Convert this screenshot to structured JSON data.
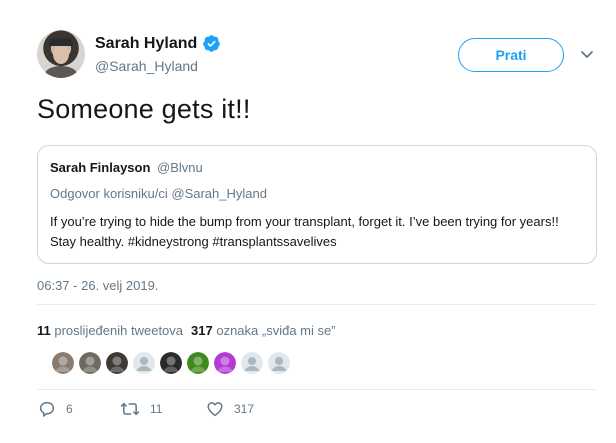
{
  "author": {
    "display_name": "Sarah Hyland",
    "handle": "@Sarah_Hyland",
    "verified": true
  },
  "follow_button": {
    "label": "Prati",
    "color": "#1da1f2"
  },
  "tweet": {
    "text": "Someone gets it!!",
    "timestamp": "06:37 - 26. velj 2019."
  },
  "quoted_tweet": {
    "display_name": "Sarah Finlayson",
    "handle": "@Blvnu",
    "reply_context": "Odgovor korisniku/ci @Sarah_Hyland",
    "text": "If you’re trying to hide the bump from your transplant, forget it. I’ve been trying for years!! Stay healthy. #kidneystrong #transplantssavelives"
  },
  "stats": {
    "retweet_count": "11",
    "retweet_label": "proslijeđenih tweetova",
    "like_count": "317",
    "like_label": "oznaka „sviđa mi se”"
  },
  "likers": [
    {
      "icon": "avatar",
      "color": "#8a7b6e"
    },
    {
      "icon": "avatar",
      "color": "#6e6a62"
    },
    {
      "icon": "avatar",
      "color": "#3c3a33"
    },
    {
      "icon": "default-avatar",
      "color": "#aab8c2"
    },
    {
      "icon": "avatar",
      "color": "#2a2a2a"
    },
    {
      "icon": "avatar",
      "color": "#3f8a1f"
    },
    {
      "icon": "avatar",
      "color": "#b43ad6"
    },
    {
      "icon": "default-avatar",
      "color": "#aab8c2"
    },
    {
      "icon": "default-avatar",
      "color": "#aab8c2"
    }
  ],
  "actions": {
    "reply_count": "6",
    "retweet_count": "11",
    "like_count": "317"
  },
  "colors": {
    "text": "#14171a",
    "secondary": "#657786",
    "accent": "#1da1f2",
    "border": "#ccd6dd"
  }
}
